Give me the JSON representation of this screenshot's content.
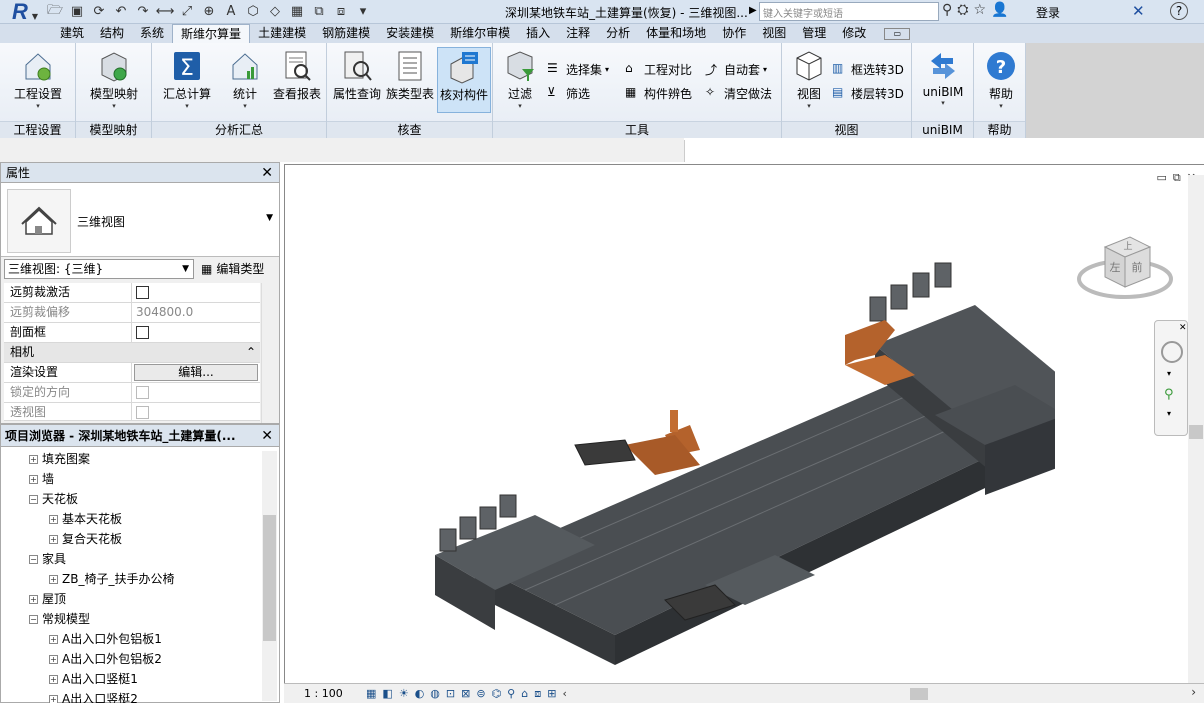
{
  "window": {
    "title": "深圳某地铁车站_土建算量(恢复) - 三维视图...",
    "search_placeholder": "键入关键字或短语",
    "login": "登录"
  },
  "ribbon_tabs": [
    "建筑",
    "结构",
    "系统",
    "斯维尔算量",
    "土建建模",
    "钢筋建模",
    "安装建模",
    "斯维尔审模",
    "插入",
    "注释",
    "分析",
    "体量和场地",
    "协作",
    "视图",
    "管理",
    "修改"
  ],
  "active_tab": "斯维尔算量",
  "panels": {
    "project_settings": {
      "label": "工程设置",
      "button": "工程设置"
    },
    "model_mapping": {
      "label": "模型映射",
      "button": "模型映射"
    },
    "analysis": {
      "label": "分析汇总",
      "buttons": [
        "汇总计算",
        "统计",
        "查看报表"
      ]
    },
    "check": {
      "label": "核查",
      "buttons": [
        "属性查询",
        "族类型表",
        "核对构件"
      ]
    },
    "tools": {
      "label": "工具",
      "filter": "过滤",
      "small": [
        "选择集",
        "工程对比",
        "自动套",
        "筛选",
        "构件辨色",
        "清空做法"
      ]
    },
    "view": {
      "label": "视图",
      "button": "视图",
      "small": [
        "框选转3D",
        "楼层转3D"
      ]
    },
    "unibim": {
      "label": "uniBIM",
      "button": "uniBIM"
    },
    "help": {
      "label": "帮助",
      "button": "帮助"
    }
  },
  "properties": {
    "header": "属性",
    "type_name": "三维视图",
    "instance": "三维视图: {三维}",
    "edit_type": "编辑类型",
    "rows": {
      "far_clip_active": "远剪裁激活",
      "far_clip_offset": "远剪裁偏移",
      "far_clip_offset_value": "304800.0",
      "section_box": "剖面框",
      "camera_group": "相机",
      "render_settings": "渲染设置",
      "render_settings_btn": "编辑...",
      "locked_orientation": "锁定的方向",
      "perspective": "透视图"
    }
  },
  "browser": {
    "header": "项目浏览器 - 深圳某地铁车站_土建算量(...",
    "items": [
      {
        "label": "填充图案",
        "exp": "+"
      },
      {
        "label": "墙",
        "exp": "+"
      },
      {
        "label": "天花板",
        "exp": "−"
      },
      {
        "label": "基本天花板",
        "exp": "+"
      },
      {
        "label": "复合天花板",
        "exp": "+"
      },
      {
        "label": "家具",
        "exp": "−"
      },
      {
        "label": "ZB_椅子_扶手办公椅",
        "exp": "+"
      },
      {
        "label": "屋顶",
        "exp": "+"
      },
      {
        "label": "常规模型",
        "exp": "−"
      },
      {
        "label": "A出入口外包铝板1",
        "exp": "+"
      },
      {
        "label": "A出入口外包铝板2",
        "exp": "+"
      },
      {
        "label": "A出入口竖梃1",
        "exp": "+"
      },
      {
        "label": "A出入口竖梃2",
        "exp": "+"
      }
    ]
  },
  "viewcube": {
    "top": "上",
    "left": "左",
    "front": "前"
  },
  "statusbar": {
    "scale": "1 : 100"
  },
  "colors": {
    "model_gray": "#555a5e",
    "model_highlight": "#b4622c",
    "ribbon_bg": "#e6ecf4",
    "tab_bg": "#d5dfec"
  }
}
